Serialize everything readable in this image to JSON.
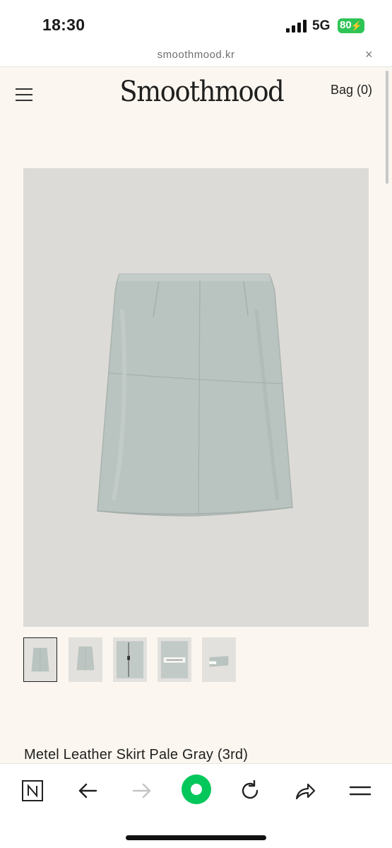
{
  "status_bar": {
    "time": "18:30",
    "network": "5G",
    "battery": "80"
  },
  "browser": {
    "url": "smoothmood.kr",
    "close_glyph": "×"
  },
  "header": {
    "logo": "Smoothmood",
    "bag_label": "Bag (0)"
  },
  "product": {
    "title": "Metel Leather Skirt Pale Gray (3rd)",
    "skirt_color": "#b9c3bf",
    "thumbnails": [
      {
        "name": "thumb-front",
        "active": true
      },
      {
        "name": "thumb-front-2",
        "active": false
      },
      {
        "name": "thumb-zipper",
        "active": false
      },
      {
        "name": "thumb-label",
        "active": false
      },
      {
        "name": "thumb-folded",
        "active": false
      }
    ]
  },
  "toolbar": {
    "icons": [
      "naver-n-icon",
      "back-arrow-icon",
      "forward-arrow-icon",
      "green-dot-icon",
      "refresh-icon",
      "share-icon",
      "menu-icon"
    ],
    "accent": "#03c75a"
  }
}
